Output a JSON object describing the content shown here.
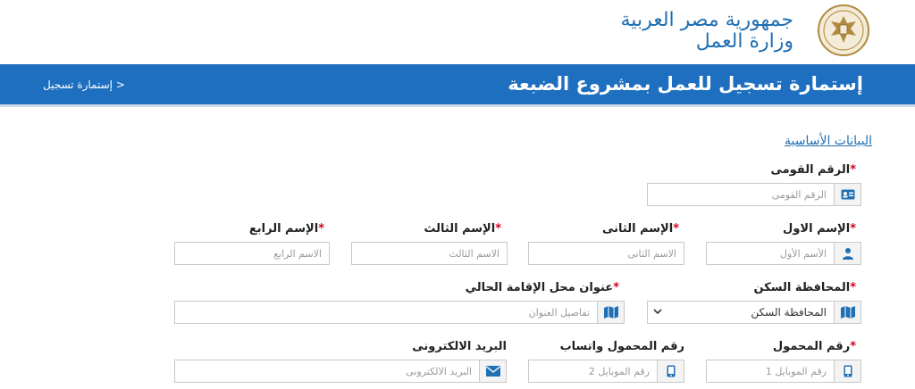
{
  "header": {
    "brand_line1": "جمهورية مصر العربية",
    "brand_line2": "وزارة العمل",
    "logo_icon": "ministry-eagle-logo-icon"
  },
  "banner": {
    "title": "إستمارة تسجيل للعمل بمشروع الضبعة",
    "breadcrumb": "< إستمارة تسجيل"
  },
  "section": {
    "title": "البيانات الأساسية"
  },
  "form": {
    "national_id": {
      "label": "الرقم القومى",
      "placeholder": "الرقم القومى",
      "required": "*"
    },
    "first_name": {
      "label": "الإسم الاول",
      "placeholder": "الأسم الأول",
      "required": "*"
    },
    "second_name": {
      "label": "الإسم الثانى",
      "placeholder": "الاسم الثانى",
      "required": "*"
    },
    "third_name": {
      "label": "الإسم الثالث",
      "placeholder": "الاسم الثالث",
      "required": "*"
    },
    "fourth_name": {
      "label": "الإسم الرابع",
      "placeholder": "الاسم الرابع",
      "required": "*"
    },
    "governorate": {
      "label": "المحافظة السكن",
      "value": "المحافظة السكن",
      "required": "*"
    },
    "address": {
      "label": "عنوان محل الإقامة الحالي",
      "placeholder": "تفاصيل العنوان",
      "required": "*"
    },
    "mobile": {
      "label": "رقم المحمول",
      "placeholder": "رقم الموبايل 1",
      "required": "*"
    },
    "whatsapp": {
      "label": "رقم المحمول واتساب",
      "placeholder": "رقم الموبايل 2"
    },
    "email": {
      "label": "البريد الالكترونى",
      "placeholder": "البريد الالكترونى"
    }
  },
  "colors": {
    "primary": "#1e6fc0",
    "brand_text": "#1f6fb3",
    "required": "#d0021b",
    "icon": "#1f6fb3"
  }
}
